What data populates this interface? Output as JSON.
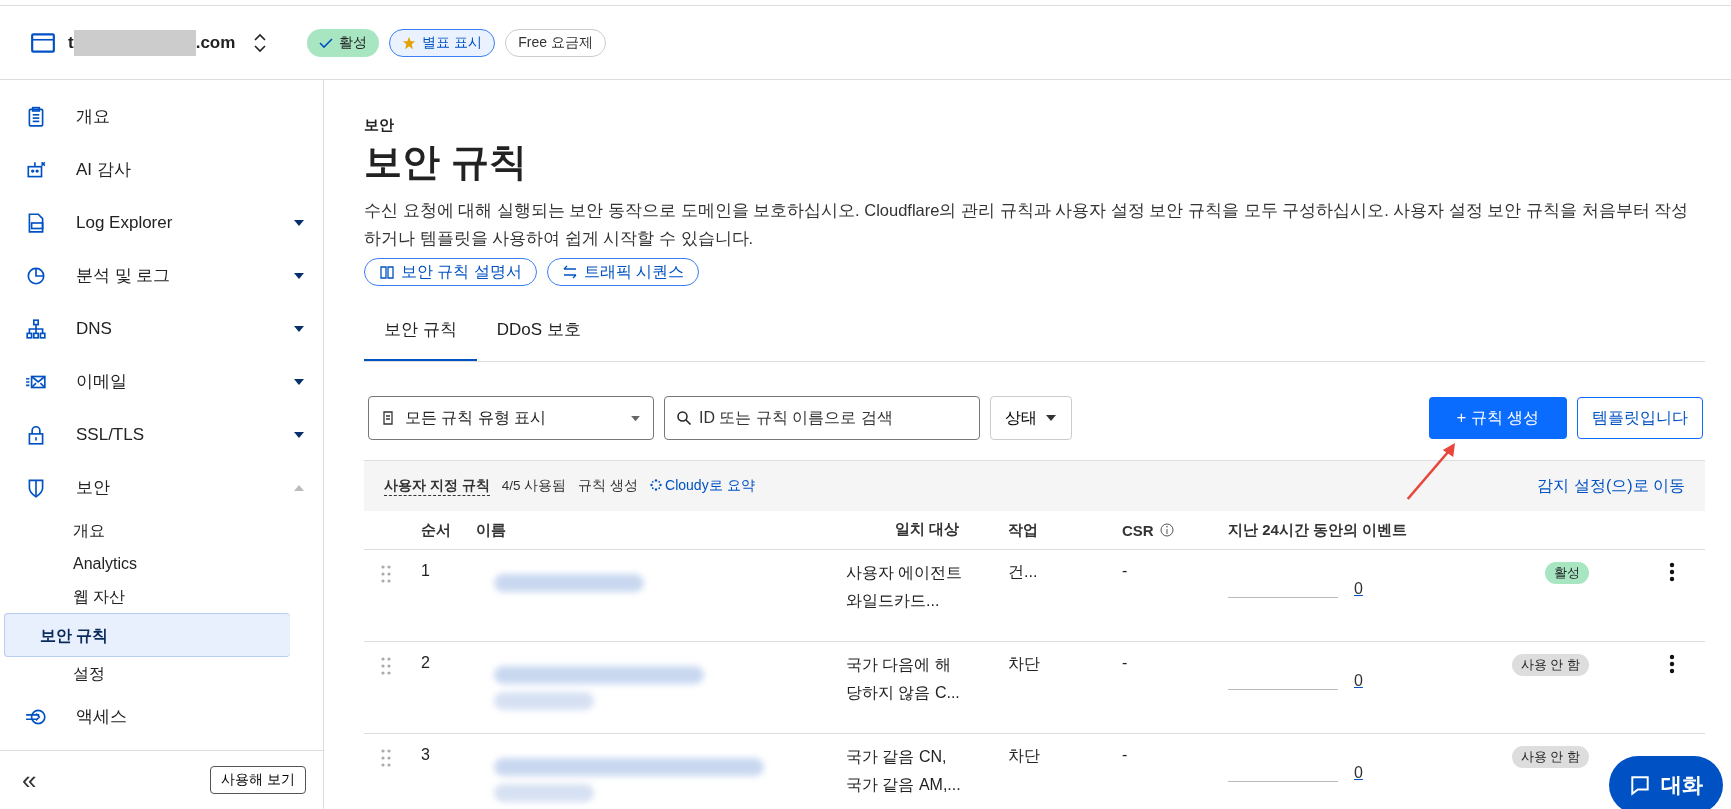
{
  "header": {
    "domain_start": "t",
    "domain_end": ".com",
    "badges": [
      {
        "kind": "status",
        "label": "활성"
      },
      {
        "kind": "star",
        "label": "별표 표시"
      },
      {
        "kind": "plan",
        "label": "Free 요금제"
      }
    ]
  },
  "sidebar": {
    "items": [
      {
        "label": "개요"
      },
      {
        "label": "AI 감사"
      },
      {
        "label": "Log Explorer",
        "expanded": false
      },
      {
        "label": "분석 및 로그",
        "expanded": false
      },
      {
        "label": "DNS",
        "expanded": false
      },
      {
        "label": "이메일",
        "expanded": false
      },
      {
        "label": "SSL/TLS",
        "expanded": false
      },
      {
        "label": "보안",
        "expanded": true,
        "children": [
          {
            "label": "개요",
            "selected": false
          },
          {
            "label": "Analytics",
            "selected": false
          },
          {
            "label": "웹 자산",
            "selected": false
          },
          {
            "label": "보안 규칙",
            "selected": true
          },
          {
            "label": "설정",
            "selected": false
          }
        ]
      },
      {
        "label": "액세스"
      }
    ],
    "collapse": "«",
    "try_button": "사용해 보기"
  },
  "page": {
    "breadcrumb": "보안",
    "title": "보안 규칙",
    "description": "수신 요청에 대해 실행되는 보안 동작으로 도메인을 보호하십시오. Cloudflare의 관리 규칙과 사용자 설정 보안 규칙을 모두 구성하십시오. 사용자 설정 보안 규칙을 처음부터 작성하거나 템플릿을 사용하여 쉽게 시작할 수 있습니다.",
    "links": [
      "보안 규칙 설명서",
      "트래픽 시퀀스"
    ],
    "tabs": [
      {
        "label": "보안 규칙",
        "selected": true
      },
      {
        "label": "DDoS 보호",
        "selected": false
      }
    ],
    "filter": "모든 규칙 유형 표시",
    "search": {
      "placeholder": "ID 또는 규칙 이름으로 검색"
    },
    "status_filter": "상태",
    "create_button": "+ 규칙 생성",
    "template_button": "템플릿입니다",
    "summary": {
      "title": "사용자 지정 규칙",
      "usage": "4/5 사용됨",
      "create": "규칙 생성",
      "cloudy": "Cloudy로 요약",
      "detect_link": "감지 설정(으)로 이동"
    },
    "table": {
      "columns": [
        "순서",
        "이름",
        "일치 대상",
        "작업",
        "CSR",
        "지난 24시간 동안의 이벤트"
      ],
      "rows": [
        {
          "order": "1",
          "name": {
            "kind": "picture"
          },
          "match": [
            "사용자 에이전트",
            "와일드카드..."
          ],
          "action": "건...",
          "csr": "-",
          "events": "0",
          "status": "활성",
          "enabled": true
        },
        {
          "order": "2",
          "name": {
            "kind": "picture"
          },
          "match": [
            "국가 다음에 해",
            "당하지 않음 C..."
          ],
          "action": "차단",
          "csr": "-",
          "events": "0",
          "status": "사용 안 함",
          "enabled": false
        },
        {
          "order": "3",
          "name": {
            "kind": "picture"
          },
          "match": [
            "국가 같음 CN,",
            "국가 같음 AM,..."
          ],
          "action": "차단",
          "csr": "-",
          "events": "0",
          "status": "사용 안 함",
          "enabled": false
        }
      ]
    }
  },
  "chat_button": "대화"
}
